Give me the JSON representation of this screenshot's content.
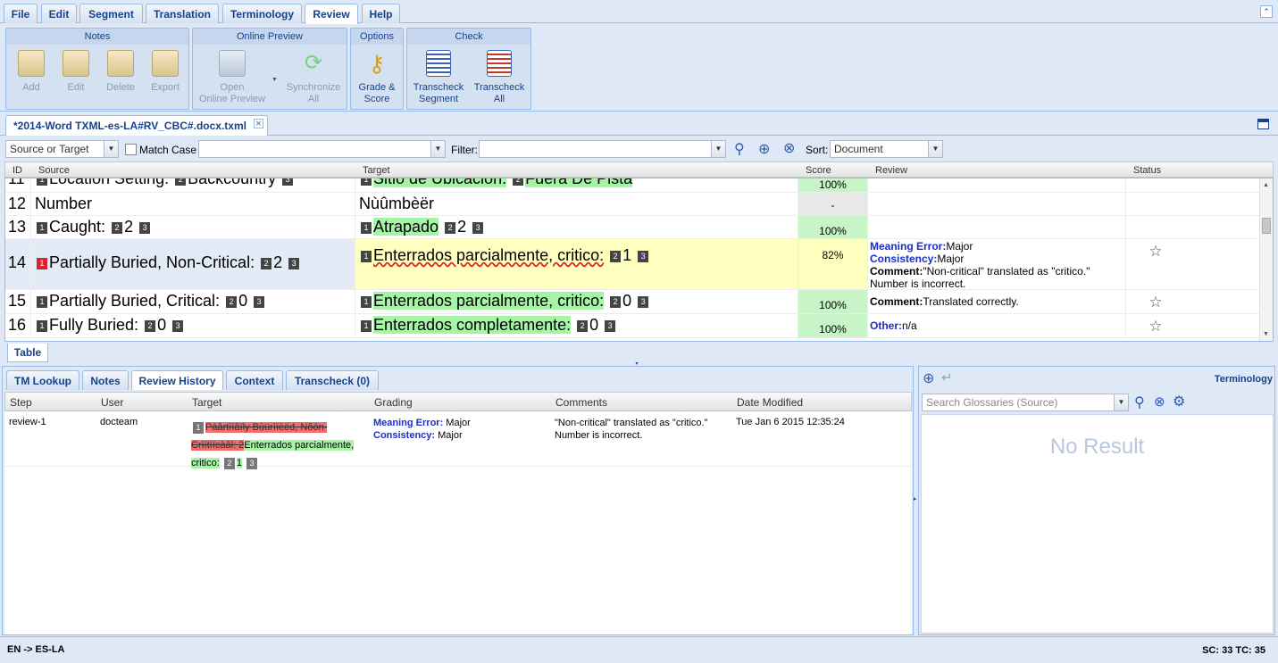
{
  "menu": [
    "File",
    "Edit",
    "Segment",
    "Translation",
    "Terminology",
    "Review",
    "Help"
  ],
  "ribbon": {
    "groups": {
      "notes": "Notes",
      "online_preview": "Online Preview",
      "options": "Options",
      "check": "Check"
    },
    "notes": {
      "add": "Add",
      "edit": "Edit",
      "delete": "Delete",
      "export": "Export"
    },
    "online": {
      "open": "Open",
      "open2": "Online Preview",
      "sync": "Synchronize",
      "sync2": "All"
    },
    "options": {
      "grade": "Grade &",
      "grade2": "Score"
    },
    "check": {
      "seg": "Transcheck",
      "seg2": "Segment",
      "all": "Transcheck",
      "all2": "All"
    }
  },
  "doc_tab": "*2014-Word TXML-es-LA#RV_CBC#.docx.txml",
  "filter": {
    "scope": "Source or Target",
    "match_case": "Match Case",
    "search_value": "",
    "filter_label": "Filter:",
    "filter_value": "",
    "sort_label": "Sort:",
    "sort_value": "Document"
  },
  "grid": {
    "headers": {
      "id": "ID",
      "source": "Source",
      "target": "Target",
      "score": "Score",
      "review": "Review",
      "status": "Status"
    },
    "rows": [
      {
        "id": "11",
        "src": "Location Setting:",
        "src2": "Backcountry",
        "tgt": "Sitio de Ubicación:",
        "tgt2": "Fuera De Pista",
        "score": "100%"
      },
      {
        "id": "12",
        "src": "Number",
        "tgt": "Nùûmbèër",
        "score": "-"
      },
      {
        "id": "13",
        "src": "Caught:",
        "src_n": "2",
        "tgt": "Atrapado",
        "tgt_n": "2",
        "score": "100%"
      },
      {
        "id": "14",
        "src": "Partially Buried, Non-Critical:",
        "src_n": "2",
        "tgt": "Enterrados parcialmente, critico:",
        "tgt_n": "1",
        "score": "82%",
        "review": [
          {
            "k": "Meaning Error:",
            "v": "Major"
          },
          {
            "k": "Consistency:",
            "v": "Major"
          },
          {
            "k": "Comment:",
            "v": "\"Non-critical\" translated as \"critico.\""
          }
        ],
        "review_extra": "Number is incorrect."
      },
      {
        "id": "15",
        "src": "Partially Buried, Critical:",
        "src_n": "0",
        "tgt": "Enterrados parcialmente, critico:",
        "tgt_n": "0",
        "score": "100%",
        "review_k": "Comment:",
        "review_v": "Translated correctly."
      },
      {
        "id": "16",
        "src": "Fully Buried:",
        "src_n": "0",
        "tgt": "Enterrados completamente",
        "tgt_n": "0",
        "score": "100%",
        "review_k": "Other:",
        "review_v": "n/a"
      }
    ],
    "tags": {
      "t1": "1",
      "t2": "2",
      "t3": "3"
    }
  },
  "table_tab": "Table",
  "lower_tabs": [
    "TM Lookup",
    "Notes",
    "Review History",
    "Context",
    "Transcheck (0)"
  ],
  "history": {
    "headers": {
      "step": "Step",
      "user": "User",
      "target": "Target",
      "grading": "Grading",
      "comments": "Comments",
      "date": "Date Modified"
    },
    "row": {
      "step": "review-1",
      "user": "docteam",
      "deleted1": "Pàârtìïâïly Bùürìïèëd, Nôón-",
      "deleted2": "Crìítìïcàâl: 2",
      "inserted1": "Enterrados parcialmente,",
      "inserted2": "critico:",
      "inserted_n": "1",
      "grading": [
        {
          "k": "Meaning Error:",
          "v": "Major"
        },
        {
          "k": "Consistency:",
          "v": "Major"
        }
      ],
      "comments1": "\"Non-critical\" translated as \"critico.\"",
      "comments2": "Number is incorrect.",
      "date": "Tue Jan 6 2015 12:35:24"
    }
  },
  "terminology": {
    "title": "Terminology",
    "search_placeholder": "Search Glossaries (Source)",
    "empty": "No Result"
  },
  "status": {
    "lang": "EN -> ES-LA",
    "counts": "SC: 33 TC: 35"
  },
  "colors": {
    "accent": "#15428b",
    "match": "#a6f5a6",
    "selected_row": "#ffffc0",
    "deleted": "#f36b6b"
  }
}
